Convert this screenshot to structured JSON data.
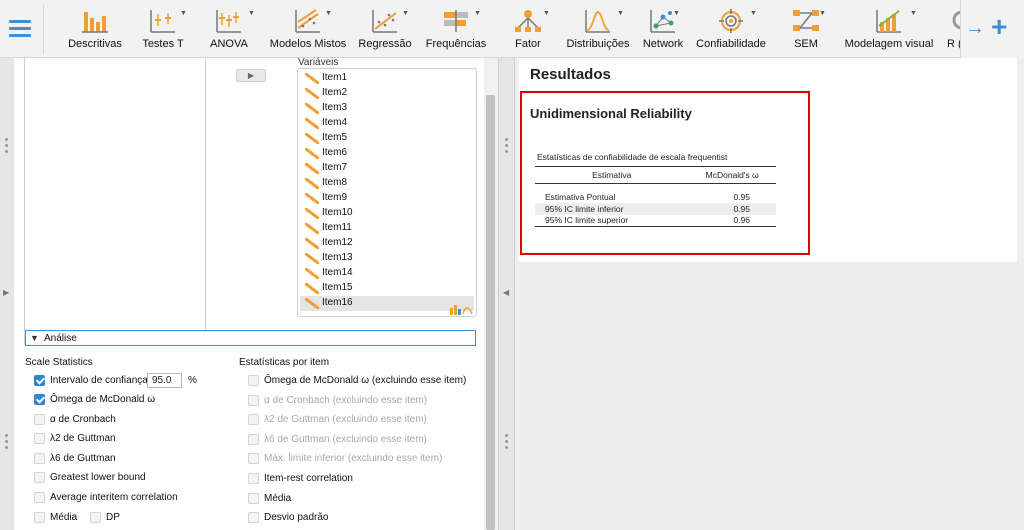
{
  "toolbar": {
    "items": [
      {
        "label": "Descritivas",
        "icon": "descriptives-icon"
      },
      {
        "label": "Testes T",
        "icon": "t-tests-icon"
      },
      {
        "label": "ANOVA",
        "icon": "anova-icon"
      },
      {
        "label": "Modelos Mistos",
        "icon": "mixed-models-icon"
      },
      {
        "label": "Regressão",
        "icon": "regression-icon"
      },
      {
        "label": "Frequências",
        "icon": "frequencies-icon"
      },
      {
        "label": "Fator",
        "icon": "factor-icon"
      },
      {
        "label": "Distribuições",
        "icon": "distributions-icon"
      },
      {
        "label": "Network",
        "icon": "network-icon"
      },
      {
        "label": "Confiabilidade",
        "icon": "reliability-icon"
      },
      {
        "label": "SEM",
        "icon": "sem-icon"
      },
      {
        "label": "Modelagem visual",
        "icon": "visual-modeling-icon"
      },
      {
        "label": "R (",
        "icon": "r-icon"
      }
    ],
    "add_icon": "plus-icon",
    "scroll_icon": "arrow-right-icon"
  },
  "variables": {
    "label": "Variáveis",
    "items": [
      "Item1",
      "Item2",
      "Item3",
      "Item4",
      "Item5",
      "Item6",
      "Item7",
      "Item8",
      "Item9",
      "Item10",
      "Item11",
      "Item12",
      "Item13",
      "Item14",
      "Item15",
      "Item16"
    ],
    "selected": "Item16"
  },
  "analysis_section": {
    "label": "Análise"
  },
  "scale_statistics": {
    "title": "Scale Statistics",
    "ci_label": "Intervalo de confiança",
    "ci_value": "95.0",
    "ci_unit": "%",
    "options": [
      {
        "label": "Ômega de McDonald ω",
        "checked": true
      },
      {
        "label": "α de Cronbach",
        "checked": false
      },
      {
        "label": "λ2 de Guttman",
        "checked": false
      },
      {
        "label": "λ6 de Guttman",
        "checked": false
      },
      {
        "label": "Greatest lower bound",
        "checked": false
      },
      {
        "label": "Average interitem correlation",
        "checked": false
      }
    ],
    "mean_label": "Média",
    "sd_label": "DP"
  },
  "item_statistics": {
    "title": "Estatísticas por item",
    "options": [
      {
        "label": "Ômega de McDonald ω (excluindo esse item)",
        "checked": false,
        "disabled": false
      },
      {
        "label": "α de Cronbach (excluindo esse item)",
        "checked": false,
        "disabled": true
      },
      {
        "label": "λ2 de Guttman (excluindo esse item)",
        "checked": false,
        "disabled": true
      },
      {
        "label": "λ6 de Guttman (excluindo esse item)",
        "checked": false,
        "disabled": true
      },
      {
        "label": "Máx. limite inferior (excluindo esse item)",
        "checked": false,
        "disabled": true
      },
      {
        "label": "Item-rest correlation",
        "checked": false,
        "disabled": false
      },
      {
        "label": "Média",
        "checked": false,
        "disabled": false
      },
      {
        "label": "Desvio padrão",
        "checked": false,
        "disabled": false
      }
    ]
  },
  "results": {
    "title": "Resultados",
    "analysis_title": "Unidimensional Reliability",
    "table": {
      "caption": "Estatísticas de confiabilidade de escala frequentist",
      "headers": [
        "Estimativa",
        "McDonald's ω"
      ],
      "rows": [
        [
          "Estimativa Pontual",
          "0.95"
        ],
        [
          "95% IC limite inferior",
          "0.95"
        ],
        [
          "95% IC limite superior",
          "0.96"
        ]
      ]
    }
  },
  "colors": {
    "accent": "#3f8fd2",
    "checkbox": "#2f86d1",
    "highlight": "#e00000",
    "toolbar_icon_orange": "#f0a033",
    "toolbar_icon_gray": "#777777"
  }
}
